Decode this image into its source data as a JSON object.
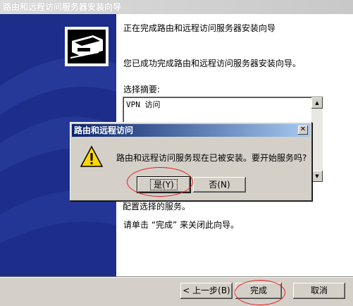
{
  "wizard": {
    "title": "路由和远程访问服务器安装向导",
    "heading": "正在完成路由和远程访问服务器安装向导",
    "intro": "您已成功完成路由和远程访问服务器安装向导。",
    "summary_label": "选择摘要:",
    "summary_text": "VPN 访问",
    "after_text_1": "配置选择的服务。",
    "after_text_2": "请单击 “完成” 来关闭此向导。",
    "buttons": {
      "back": "< 上一步(B)",
      "finish": "完成",
      "cancel": "取消"
    }
  },
  "dialog": {
    "title": "路由和远程访问",
    "message": "路由和远程访问服务现在已被安装。要开始服务吗?",
    "yes": "是(Y)",
    "no": "否(N)"
  },
  "colors": {
    "side_panel": "#1c2d8a",
    "dialog_title": "#0a246a",
    "annotation": "#e02020"
  }
}
